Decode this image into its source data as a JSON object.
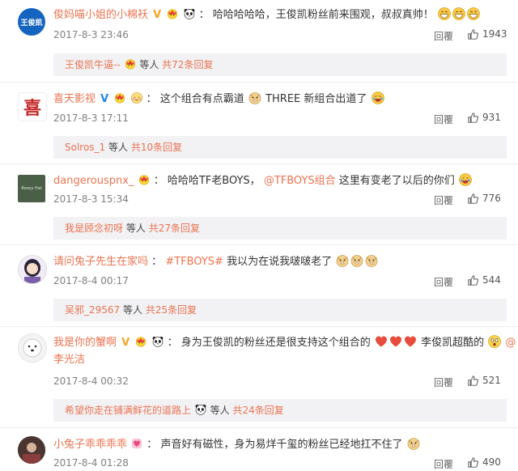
{
  "comments": [
    {
      "username": "俊妈喵小姐的小棉袄",
      "avatar_text": "王俊凯",
      "body": "哈哈哈哈哈，王俊凯粉丝前来围观，叔叔真帅！",
      "date": "2017-8-3 23:46",
      "reply_label": "回覆",
      "likes": "1943",
      "sub": {
        "name": "王俊凯牛逼--",
        "rest": "等人",
        "count": "共72条回复"
      }
    },
    {
      "username": "喜天影视",
      "avatar_text": "喜",
      "body": "这个组合有点霸道",
      "body2": "THREE 新组合出道了",
      "date": "2017-8-3 17:11",
      "reply_label": "回覆",
      "likes": "931",
      "sub": {
        "name": "Solros_1",
        "rest": "等人",
        "count": "共10条回复"
      }
    },
    {
      "username": "dangerouspnx_",
      "avatar_text": "Rosey Hat",
      "body": "哈哈哈TF老BOYS，",
      "mention": "@TFBOYS组合",
      "body2": "这里有变老了以后的你们",
      "date": "2017-8-3 15:34",
      "reply_label": "回覆",
      "likes": "776",
      "sub": {
        "name": "我是顾念初呀",
        "rest": "等人",
        "count": "共27条回复"
      }
    },
    {
      "username": "请问兔子先生在家吗",
      "topic": "#TFBOYS#",
      "body": "我以为在说我啵啵老了",
      "date": "2017-8-4 00:17",
      "reply_label": "回覆",
      "likes": "544",
      "sub": {
        "name": "吴邪_29567",
        "rest": "等人",
        "count": "共25条回复"
      }
    },
    {
      "username": "我是你的蟹啊",
      "body": "身为王俊凯的粉丝还是很支持这个组合的",
      "body2": "李俊凯超酷的",
      "mention": "@",
      "line2": "李光洁",
      "date": "2017-8-4 00:32",
      "reply_label": "回覆",
      "likes": "521",
      "sub": {
        "name": "希望你走在铺满鲜花的道路上",
        "rest": "等人",
        "count": "共24条回复"
      }
    },
    {
      "username": "小兔子乖乖乖乖",
      "body": "声音好有磁性，身为易烊千玺的粉丝已经地扛不住了",
      "date": "2017-8-4 01:28",
      "reply_label": "回覆",
      "likes": "490"
    }
  ],
  "colors": {
    "accent": "#eb7350",
    "vip": "#f5a623",
    "sub_bg": "#f2f2f5"
  }
}
